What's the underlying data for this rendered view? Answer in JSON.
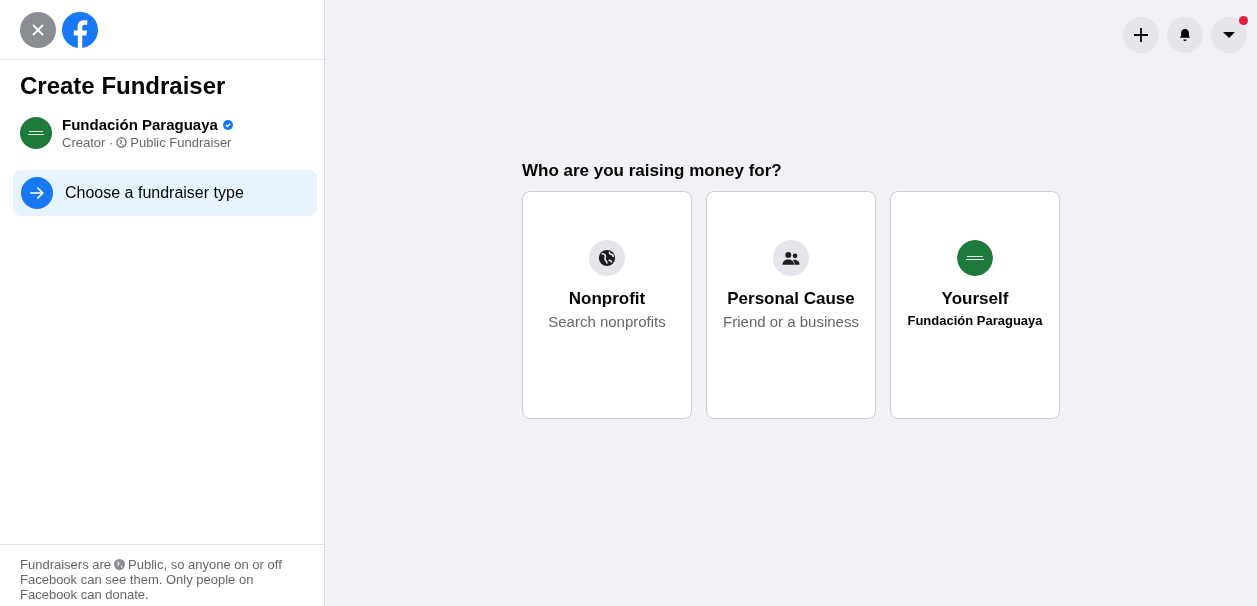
{
  "sidebar": {
    "title": "Create Fundraiser",
    "organizer": {
      "name": "Fundación Paraguaya",
      "verified": true,
      "role": "Creator ·",
      "visibility": "Public Fundraiser"
    },
    "steps": [
      {
        "label": "Choose a fundraiser type",
        "selected": true
      }
    ],
    "footer": {
      "before": "Fundraisers are",
      "after": "Public, so anyone on or off Facebook can see them. Only people on Facebook can donate."
    }
  },
  "topbar": {
    "buttons": [
      {
        "kind": "plus",
        "badge": false
      },
      {
        "kind": "bell",
        "badge": false
      },
      {
        "kind": "caret",
        "badge": true
      }
    ]
  },
  "main": {
    "question": "Who are you raising money for?",
    "options": [
      {
        "kind": "globe",
        "title": "Nonprofit",
        "subtitle": "Search nonprofits"
      },
      {
        "kind": "people",
        "title": "Personal Cause",
        "subtitle": "Friend or a business"
      },
      {
        "kind": "logo",
        "title": "Yourself",
        "subtitle": "Fundación Paraguaya"
      }
    ]
  }
}
